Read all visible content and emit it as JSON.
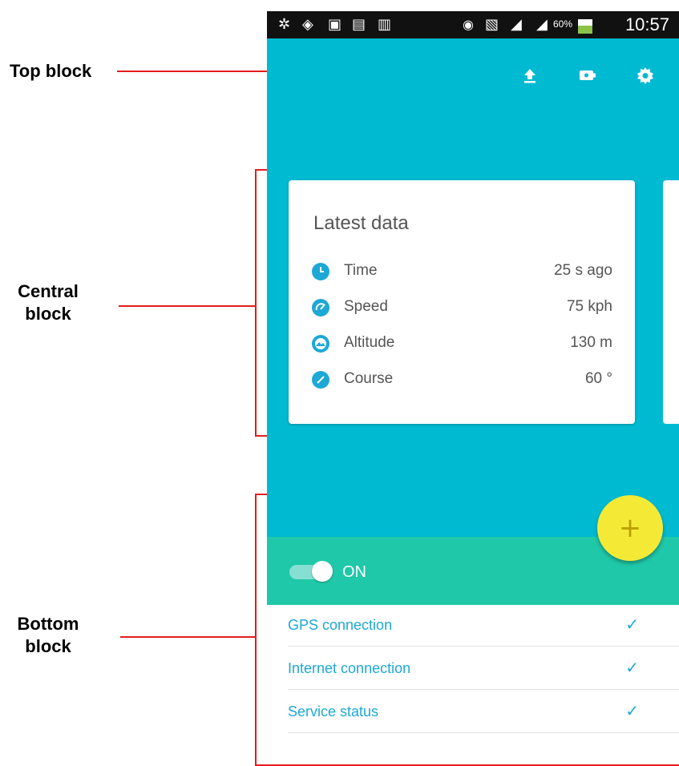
{
  "annotations": {
    "top_label": "Top block",
    "central_label_1": "Central",
    "central_label_2": "block",
    "bottom_label_1": "Bottom",
    "bottom_label_2": "block"
  },
  "status_bar": {
    "battery": "60%",
    "time": "10:57"
  },
  "toolbar": {
    "icons": [
      "upload-icon",
      "battery-icon",
      "settings-icon"
    ]
  },
  "card": {
    "title": "Latest data",
    "rows": [
      {
        "label": "Time",
        "value": "25 s ago",
        "icon": "clock-icon"
      },
      {
        "label": "Speed",
        "value": "75 kph",
        "icon": "speedometer-icon"
      },
      {
        "label": "Altitude",
        "value": "130 m",
        "icon": "mountain-icon"
      },
      {
        "label": "Course",
        "value": "60 °",
        "icon": "compass-icon"
      }
    ]
  },
  "switch": {
    "label": "ON",
    "state": "on"
  },
  "fab": {
    "symbol": "+"
  },
  "status_list": [
    {
      "label": "GPS connection",
      "check": "✓"
    },
    {
      "label": "Internet connection",
      "check": "✓"
    },
    {
      "label": "Service status",
      "check": "✓"
    }
  ],
  "colors": {
    "primary": "#00bad2",
    "accent_green": "#1fc8a8",
    "fab": "#f4ea36",
    "link": "#1da8d6",
    "annotation_red": "#e21d1d"
  }
}
